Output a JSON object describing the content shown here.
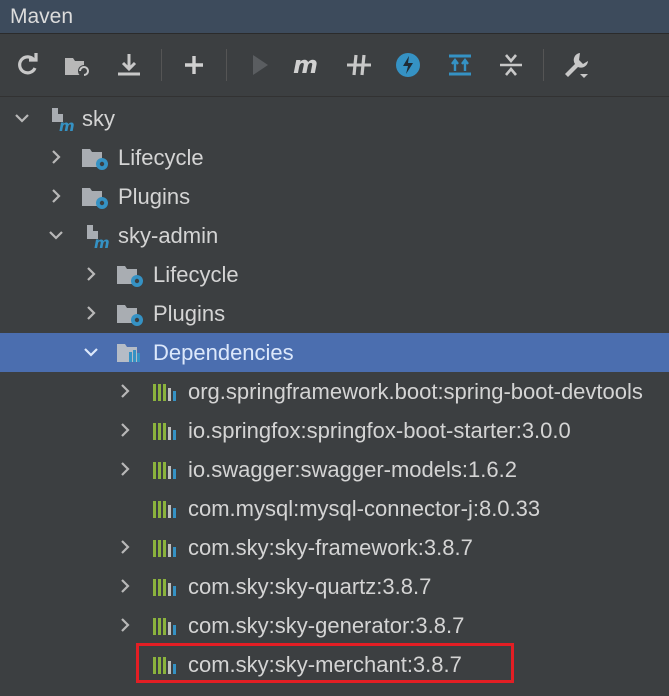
{
  "panel": {
    "title": "Maven"
  },
  "toolbar": {
    "buttons": [
      "reload-icon",
      "generate-sources-icon",
      "download-icon",
      "add-icon",
      "run-icon",
      "execute-goal-icon",
      "toggle-offline-icon",
      "skip-tests-icon",
      "show-dependencies-icon",
      "collapse-all-icon",
      "settings-icon"
    ]
  },
  "tree": {
    "root": {
      "label": "sky",
      "expanded": true
    },
    "root_lifecycle": {
      "label": "Lifecycle"
    },
    "root_plugins": {
      "label": "Plugins"
    },
    "module": {
      "label": "sky-admin",
      "expanded": true
    },
    "module_lifecycle": {
      "label": "Lifecycle"
    },
    "module_plugins": {
      "label": "Plugins"
    },
    "dependencies": {
      "label": "Dependencies",
      "selected": true
    },
    "deps": [
      {
        "label": "org.springframework.boot:spring-boot-devtools",
        "expandable": true
      },
      {
        "label": "io.springfox:springfox-boot-starter:3.0.0",
        "expandable": true
      },
      {
        "label": "io.swagger:swagger-models:1.6.2",
        "expandable": true
      },
      {
        "label": "com.mysql:mysql-connector-j:8.0.33",
        "expandable": false
      },
      {
        "label": "com.sky:sky-framework:3.8.7",
        "expandable": true
      },
      {
        "label": "com.sky:sky-quartz:3.8.7",
        "expandable": true
      },
      {
        "label": "com.sky:sky-generator:3.8.7",
        "expandable": true
      },
      {
        "label": "com.sky:sky-merchant:3.8.7",
        "expandable": false
      }
    ]
  },
  "colors": {
    "selection": "#4b6eaf",
    "highlight_border": "#e31e24",
    "background": "#3c3f41"
  }
}
